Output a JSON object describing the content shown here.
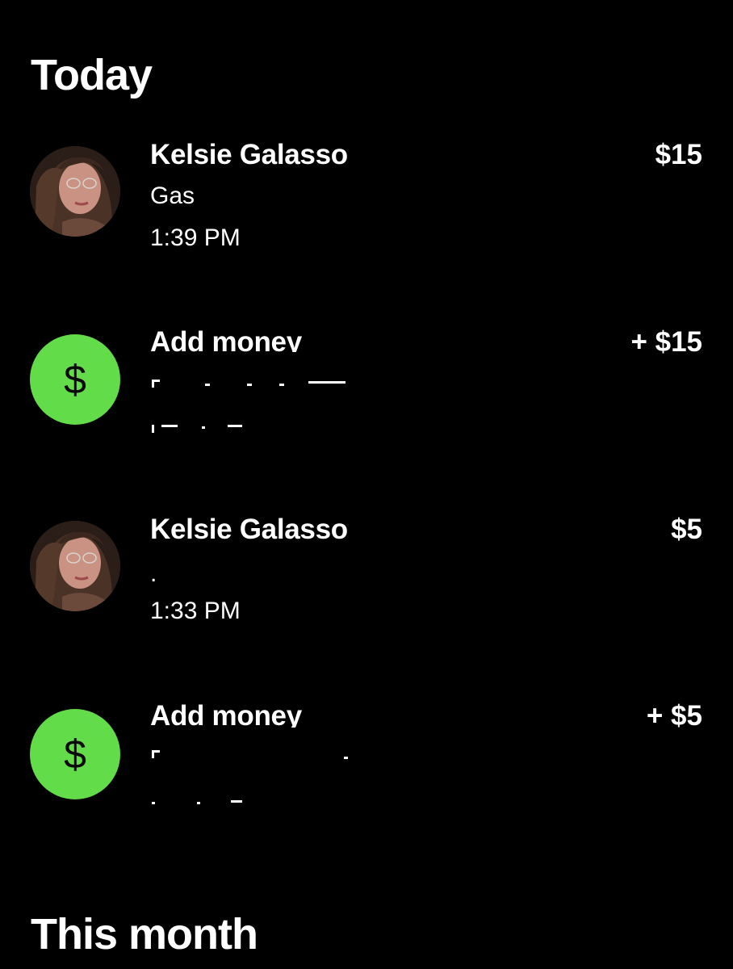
{
  "sections": {
    "today": "Today",
    "this_month": "This month"
  },
  "transactions": [
    {
      "name": "Kelsie Galasso",
      "note": "Gas",
      "time": "1:39 PM",
      "amount": "$15",
      "icon": "avatar"
    },
    {
      "name": "Add money",
      "note": "",
      "time": "",
      "amount": "+ $15",
      "icon": "dollar-icon"
    },
    {
      "name": "Kelsie Galasso",
      "note": ".",
      "time": "1:33 PM",
      "amount": "$5",
      "icon": "avatar"
    },
    {
      "name": "Add money",
      "note": "",
      "time": "",
      "amount": "+ $5",
      "icon": "dollar-icon"
    }
  ],
  "icons": {
    "dollar_glyph": "$"
  },
  "colors": {
    "background": "#000000",
    "text": "#ffffff",
    "cash_green": "#63dc4a"
  }
}
